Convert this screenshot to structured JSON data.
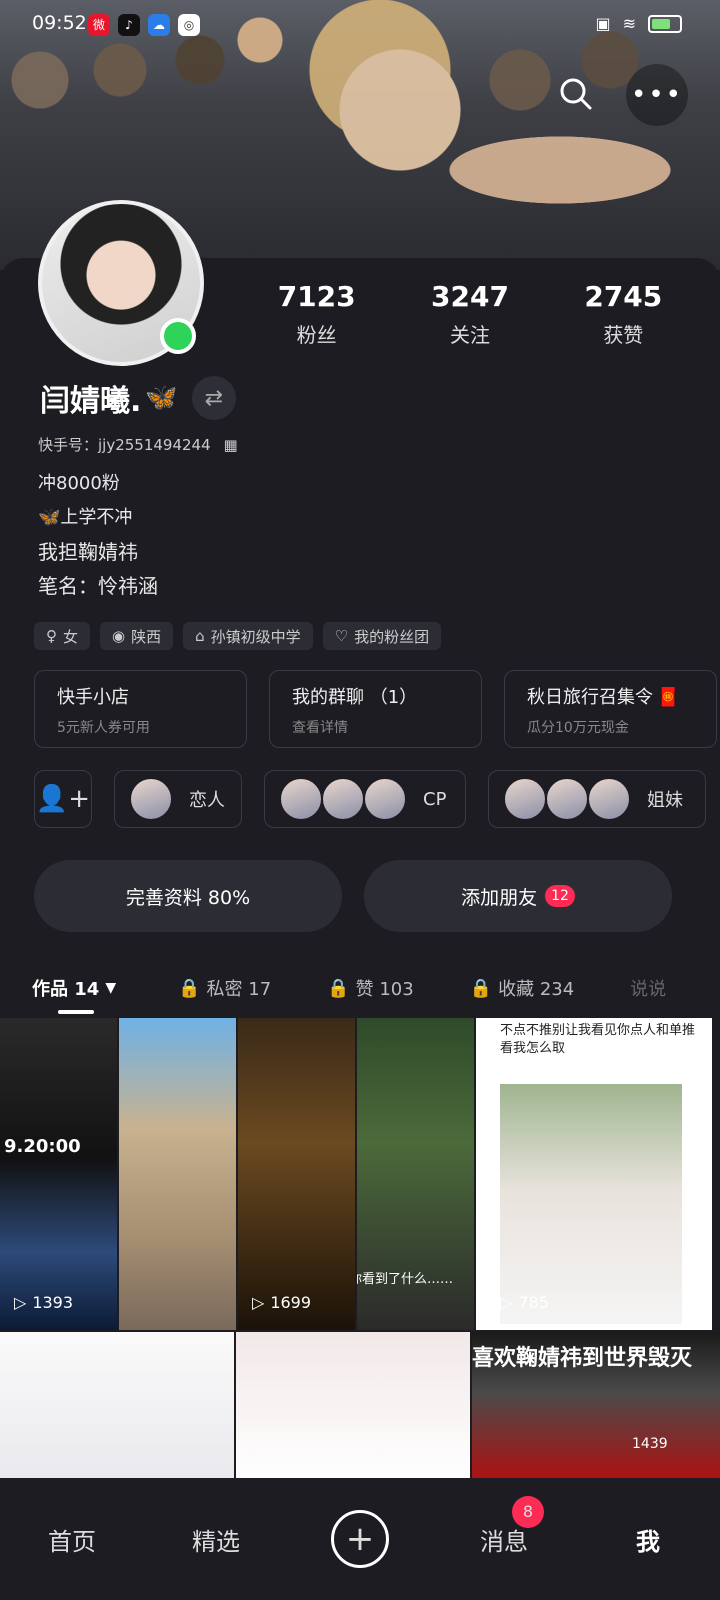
{
  "status_bar": {
    "time": "09:52",
    "app_icons": [
      "weibo-icon",
      "tiktok-icon",
      "weather-icon",
      "browser-icon"
    ],
    "right_icons": [
      "sim-icon",
      "wifi-icon",
      "battery-icon"
    ]
  },
  "header": {
    "search_icon": "search-icon",
    "more_icon": "more-icon"
  },
  "profile": {
    "name": "闫婧曦.",
    "kuaishou_id": "快手号：jjy2551494244",
    "stats": [
      {
        "value": "7123",
        "label": "粉丝"
      },
      {
        "value": "3247",
        "label": "关注"
      },
      {
        "value": "2745",
        "label": "获赞"
      }
    ],
    "bio_lines": [
      "冲8000粉",
      "上学不冲",
      "我担鞠婧祎",
      "笔名：怜祎涵"
    ],
    "tags": [
      {
        "icon": "gender-icon",
        "text": "女"
      },
      {
        "icon": "location-icon",
        "text": "陕西"
      },
      {
        "icon": "school-icon",
        "text": "孙镇初级中学"
      },
      {
        "icon": "heart-icon",
        "text": "我的粉丝团"
      }
    ]
  },
  "cards": [
    {
      "title": "快手小店",
      "sub": "5元新人券可用"
    },
    {
      "title": "我的群聊 （1）",
      "sub": "查看详情"
    },
    {
      "title": "秋日旅行召集令",
      "sub": "瓜分10万元现金"
    }
  ],
  "friends": {
    "groups": [
      {
        "label": "恋人",
        "count": 1
      },
      {
        "label": "CP",
        "count": 3
      },
      {
        "label": "姐妹",
        "count": 3
      }
    ]
  },
  "actions": {
    "complete_profile": "完善资料 80%",
    "add_friends": "添加朋友",
    "add_friends_badge": "12"
  },
  "tabs": [
    {
      "label": "作品 14",
      "locked": false
    },
    {
      "label": "私密 17",
      "locked": true
    },
    {
      "label": "赞 103",
      "locked": true
    },
    {
      "label": "收藏 234",
      "locked": true
    },
    {
      "label": "说说",
      "locked": false
    }
  ],
  "grid": {
    "tiles": [
      {
        "plays": "1393"
      },
      {
        "plays": ""
      },
      {
        "plays": "1699"
      },
      {
        "plays": ""
      },
      {
        "plays": "785",
        "caption": "不点不推别让我看见你点人和单推看我怎么取"
      }
    ],
    "tile2_text": "9.20:00",
    "tile3_text": "眯着眼，你看到了什么……",
    "row2": [
      {
        "text": ""
      },
      {
        "text": ""
      },
      {
        "text": "喜欢鞠婧祎到世界毁灭",
        "plays": "1439"
      }
    ]
  },
  "bottom_nav": {
    "items": [
      "首页",
      "精选",
      "",
      "消息",
      "我"
    ],
    "message_badge": "8"
  },
  "colors": {
    "background": "#1c1c22",
    "accent": "#fe2c55",
    "online": "#2fd35a"
  }
}
